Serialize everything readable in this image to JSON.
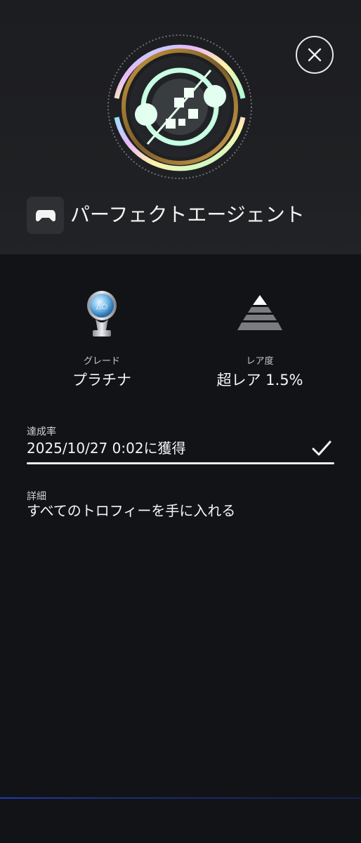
{
  "header": {
    "close_icon": "close-icon",
    "trophy_icon": "trophy-artwork",
    "game_icon": "gamepad-icon",
    "trophy_name": "パーフェクトエージェント"
  },
  "stats": {
    "grade": {
      "label": "グレード",
      "value": "プラチナ",
      "icon": "platinum-trophy-icon"
    },
    "rarity": {
      "label": "レア度",
      "value": "超レア 1.5%",
      "icon": "rarity-pyramid-icon"
    }
  },
  "achievement": {
    "label": "達成率",
    "date_text": "2025/10/27  0:02に獲得",
    "progress_percent": 100,
    "status_icon": "checkmark-icon"
  },
  "detail": {
    "label": "詳細",
    "text": "すべてのトロフィーを手に入れる"
  },
  "colors": {
    "background": "#121316",
    "header_background": "#1f2023",
    "text_primary": "#f4f4f4",
    "text_secondary": "#c7c7c7",
    "accent_line": "#1c3fb8"
  }
}
